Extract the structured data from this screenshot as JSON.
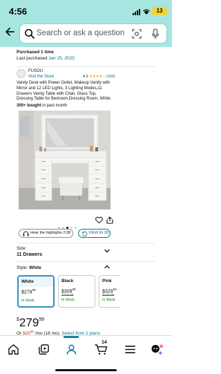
{
  "status_bar": {
    "time": "4:56",
    "battery": "13"
  },
  "search": {
    "placeholder": "Search or ask a question"
  },
  "purchase": {
    "line1": "Purchased 1 time",
    "line2_prefix": "Last purchased",
    "line2_date": "Jan 25, 2025"
  },
  "seller": {
    "brand": "FUSOU",
    "visit_link": "Visit the Store"
  },
  "rating": {
    "value": "4.2",
    "stars": "★★★★☆",
    "count": "(299)"
  },
  "product": {
    "title": "Vanity Desk with Power Outlet, Makeup Vanity with Mirror and 12 LED Lights, 3 Lighting Modes,11 Drawers Vanity Table with Chair, Glass Top, Dressing Table for Bedroom,Dressing Room, White",
    "bought_bold": "300+ bought",
    "bought_rest": " in past month"
  },
  "carousel": {
    "total": 5,
    "active": 2
  },
  "buttons": {
    "highlights": "Hear the highlights 2:08",
    "view3d": "VIEW IN 3D"
  },
  "size": {
    "label": "Size:",
    "value": "11 Drawers"
  },
  "style": {
    "label": "Style:",
    "value": "White",
    "options": [
      {
        "name": "White",
        "price": "$279",
        "cents": "99",
        "list": "",
        "stock": "In Stock"
      },
      {
        "name": "Black",
        "price": "$309",
        "cents": "99",
        "list": "$329.99",
        "stock": "In Stock"
      },
      {
        "name": "Pink",
        "price": "$329",
        "cents": "99",
        "list": "$349.99",
        "stock": "In Stock"
      }
    ]
  },
  "price": {
    "symbol": "$",
    "whole": "279",
    "cents": "99"
  },
  "plan": {
    "or": "Or",
    "amount": "$20",
    "amount_cents": "36",
    "term": "/mo (18 mo).",
    "link": "Select from 2 plans"
  },
  "nav": {
    "cart_count": "14"
  },
  "colors": {
    "accent": "#007185",
    "header_bg": "#a6e6e0",
    "price_red": "#b12704",
    "stock_green": "#007600"
  }
}
